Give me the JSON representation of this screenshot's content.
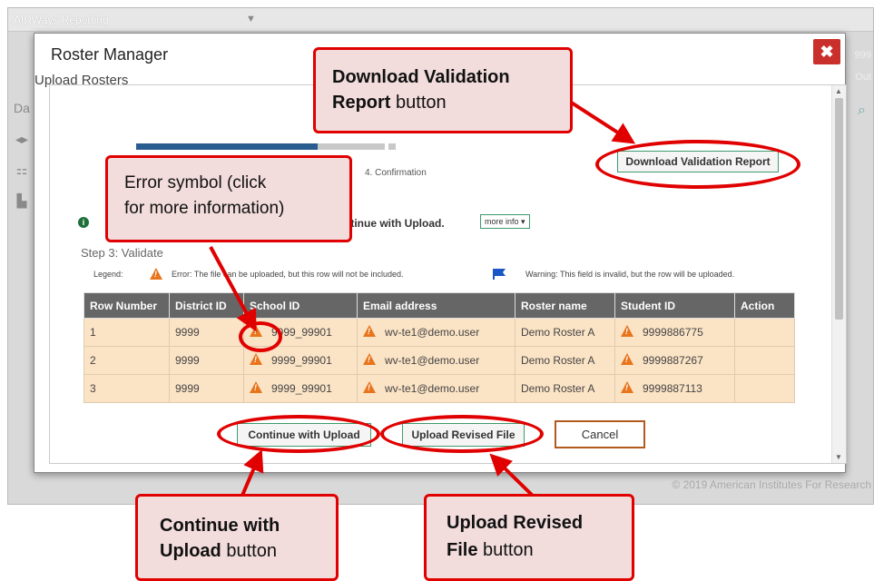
{
  "background_app": {
    "brand": "AIRWays Reporting",
    "right_text_1": "999",
    "right_text_2": "Out",
    "side_label": "Da",
    "footer": "© 2019 American Institutes For Research"
  },
  "modal": {
    "title": "Roster Manager",
    "close_icon": "close-x-icon"
  },
  "upload": {
    "title": "Upload Rosters",
    "step4_label": "4. Confirmation",
    "download_button": "Download Validation Report",
    "continue_text": "ntinue with Upload.",
    "more_info": "more info",
    "step3": "Step 3: Validate",
    "legend_label": "Legend:",
    "legend_error": "Error: The file can be uploaded, but this row will not be included.",
    "legend_warning": "Warning: This field is invalid, but the row will be uploaded."
  },
  "table": {
    "headers": [
      "Row Number",
      "District ID",
      "School ID",
      "Email address",
      "Roster name",
      "Student ID",
      "Action"
    ],
    "rows": [
      {
        "row": "1",
        "district": "9999",
        "school": "9999_99901",
        "email": "wv-te1@demo.user",
        "roster": "Demo Roster A",
        "student": "9999886775"
      },
      {
        "row": "2",
        "district": "9999",
        "school": "9999_99901",
        "email": "wv-te1@demo.user",
        "roster": "Demo Roster A",
        "student": "9999887267"
      },
      {
        "row": "3",
        "district": "9999",
        "school": "9999_99901",
        "email": "wv-te1@demo.user",
        "roster": "Demo Roster A",
        "student": "9999887113"
      }
    ]
  },
  "buttons": {
    "continue": "Continue with Upload",
    "revised": "Upload Revised File",
    "cancel": "Cancel"
  },
  "callouts": {
    "download_bold": "Download Validation",
    "download_bold2": "Report",
    "download_rest": " button",
    "error_line1": "Error symbol (click",
    "error_line2": "for more information)",
    "continue_bold": "Continue with",
    "continue_bold2": "Upload",
    "continue_rest": " button",
    "revised_bold": "Upload Revised",
    "revised_bold2": "File",
    "revised_rest": " button"
  },
  "colors": {
    "callout_border": "#e00000",
    "callout_fill": "#f2dcdc",
    "close_button": "#c9302c",
    "error_icon": "#e8741c",
    "warning_flag": "#1a56c5",
    "table_header": "#666666",
    "row_fill": "#fbe3c5"
  }
}
